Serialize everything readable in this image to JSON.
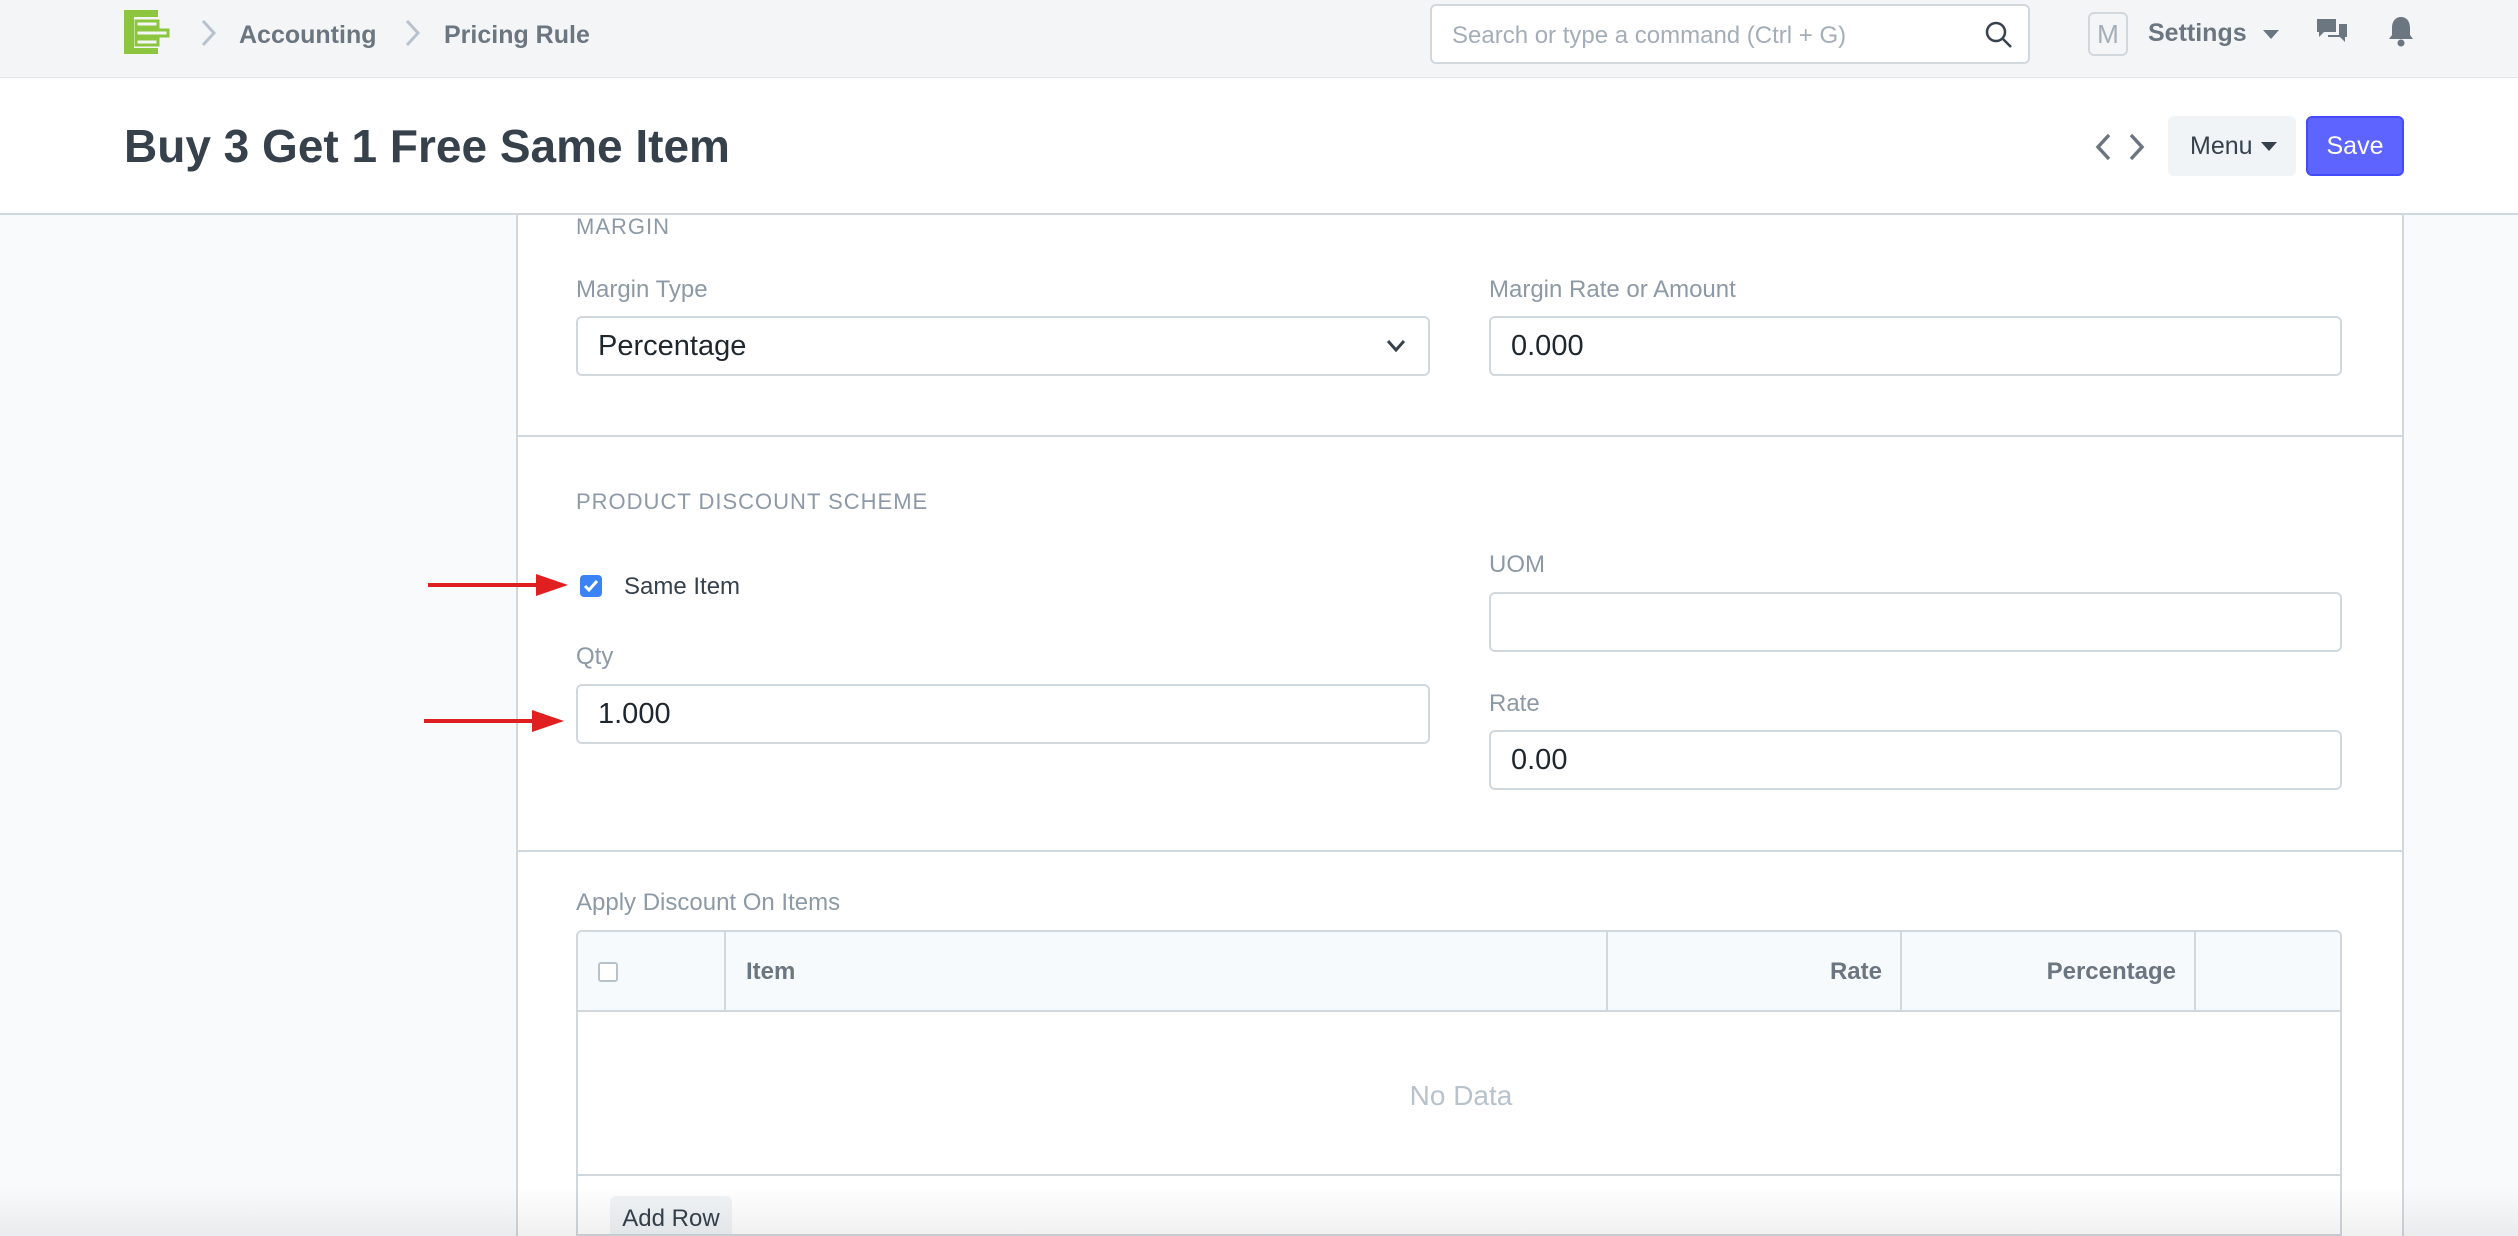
{
  "navbar": {
    "breadcrumbs": [
      "Accounting",
      "Pricing Rule"
    ],
    "search_placeholder": "Search or type a command (Ctrl + G)",
    "avatar_initial": "M",
    "settings_label": "Settings"
  },
  "page": {
    "title": "Buy 3 Get 1 Free Same Item",
    "menu_label": "Menu",
    "save_label": "Save"
  },
  "margin_section": {
    "heading": "MARGIN",
    "margin_type_label": "Margin Type",
    "margin_type_value": "Percentage",
    "margin_rate_label": "Margin Rate or Amount",
    "margin_rate_value": "0.000"
  },
  "product_discount": {
    "heading": "PRODUCT DISCOUNT SCHEME",
    "same_item_label": "Same Item",
    "same_item_checked": true,
    "qty_label": "Qty",
    "qty_value": "1.000",
    "uom_label": "UOM",
    "uom_value": "",
    "rate_label": "Rate",
    "rate_value": "0.00"
  },
  "apply_discount": {
    "label": "Apply Discount On Items",
    "columns": [
      "Item",
      "Rate",
      "Percentage"
    ],
    "empty_text": "No Data",
    "add_row_label": "Add Row"
  },
  "colors": {
    "primary": "#5e64ff",
    "checkbox": "#3b82f6",
    "annotation_arrow": "#e02020",
    "logo": "#8cc63f"
  }
}
